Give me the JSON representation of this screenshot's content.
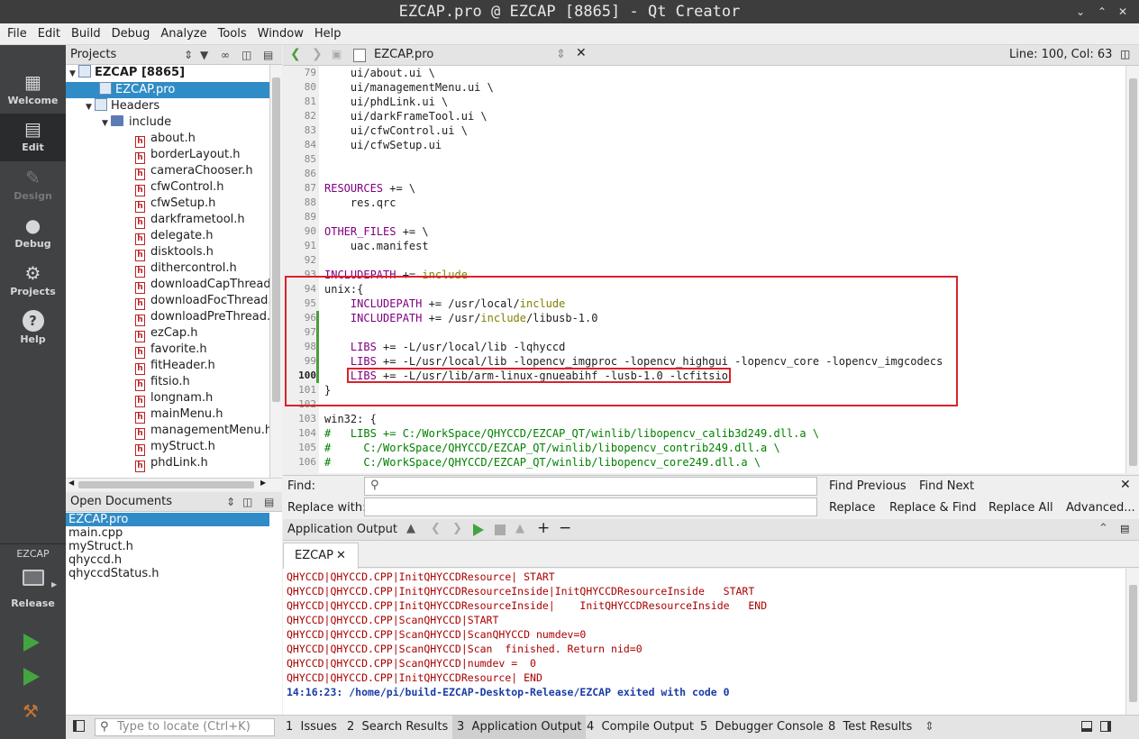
{
  "window": {
    "title": "EZCAP.pro @ EZCAP [8865] - Qt Creator"
  },
  "menu": [
    "File",
    "Edit",
    "Build",
    "Debug",
    "Analyze",
    "Tools",
    "Window",
    "Help"
  ],
  "modes": [
    {
      "label": "Welcome",
      "icon": "grid-icon"
    },
    {
      "label": "Edit",
      "icon": "document-icon"
    },
    {
      "label": "Design",
      "icon": "pen-icon"
    },
    {
      "label": "Debug",
      "icon": "bug-icon"
    },
    {
      "label": "Projects",
      "icon": "wrench-icon"
    },
    {
      "label": "Help",
      "icon": "help-icon"
    }
  ],
  "kit": {
    "project": "EZCAP",
    "config": "Release"
  },
  "projects_pane": {
    "title": "Projects",
    "root": "EZCAP [8865]",
    "pro_file": "EZCAP.pro",
    "headers": "Headers",
    "include": "include",
    "files": [
      "about.h",
      "borderLayout.h",
      "cameraChooser.h",
      "cfwControl.h",
      "cfwSetup.h",
      "darkframetool.h",
      "delegate.h",
      "disktools.h",
      "dithercontrol.h",
      "downloadCapThread.h",
      "downloadFocThread.h",
      "downloadPreThread.h",
      "ezCap.h",
      "favorite.h",
      "fitHeader.h",
      "fitsio.h",
      "longnam.h",
      "mainMenu.h",
      "managementMenu.h",
      "myStruct.h",
      "phdLink.h"
    ]
  },
  "open_documents": {
    "title": "Open Documents",
    "items": [
      "EZCAP.pro",
      "main.cpp",
      "myStruct.h",
      "qhyccd.h",
      "qhyccdStatus.h"
    ]
  },
  "editor": {
    "file": "EZCAP.pro",
    "position": "Line: 100, Col: 63",
    "lines": [
      {
        "n": "79",
        "parts": [
          {
            "t": "    ui/about.ui \\"
          }
        ]
      },
      {
        "n": "80",
        "parts": [
          {
            "t": "    ui/managementMenu.ui \\"
          }
        ]
      },
      {
        "n": "81",
        "parts": [
          {
            "t": "    ui/phdLink.ui \\"
          }
        ]
      },
      {
        "n": "82",
        "parts": [
          {
            "t": "    ui/darkFrameTool.ui \\"
          }
        ]
      },
      {
        "n": "83",
        "parts": [
          {
            "t": "    ui/cfwControl.ui \\"
          }
        ]
      },
      {
        "n": "84",
        "parts": [
          {
            "t": "    ui/cfwSetup.ui"
          }
        ]
      },
      {
        "n": "85",
        "parts": [
          {
            "t": ""
          }
        ]
      },
      {
        "n": "86",
        "parts": [
          {
            "t": ""
          }
        ]
      },
      {
        "n": "87",
        "parts": [
          {
            "t": "RESOURCES",
            "c": "kw"
          },
          {
            "t": " += \\"
          }
        ]
      },
      {
        "n": "88",
        "parts": [
          {
            "t": "    res.qrc"
          }
        ]
      },
      {
        "n": "89",
        "parts": [
          {
            "t": ""
          }
        ]
      },
      {
        "n": "90",
        "parts": [
          {
            "t": "OTHER_FILES",
            "c": "kw"
          },
          {
            "t": " += \\"
          }
        ]
      },
      {
        "n": "91",
        "parts": [
          {
            "t": "    uac.manifest"
          }
        ]
      },
      {
        "n": "92",
        "parts": [
          {
            "t": ""
          }
        ]
      },
      {
        "n": "93",
        "parts": [
          {
            "t": "INCLUDEPATH",
            "c": "kw"
          },
          {
            "t": " += "
          },
          {
            "t": "include",
            "c": "inc"
          }
        ]
      },
      {
        "n": "94",
        "parts": [
          {
            "t": "unix:{"
          }
        ]
      },
      {
        "n": "95",
        "parts": [
          {
            "t": "    "
          },
          {
            "t": "INCLUDEPATH",
            "c": "kw"
          },
          {
            "t": " += /usr/local/"
          },
          {
            "t": "include",
            "c": "inc"
          }
        ]
      },
      {
        "n": "96",
        "parts": [
          {
            "t": "    "
          },
          {
            "t": "INCLUDEPATH",
            "c": "kw"
          },
          {
            "t": " += /usr/"
          },
          {
            "t": "include",
            "c": "inc"
          },
          {
            "t": "/libusb-1.0"
          }
        ]
      },
      {
        "n": "97",
        "parts": [
          {
            "t": ""
          }
        ]
      },
      {
        "n": "98",
        "parts": [
          {
            "t": "    "
          },
          {
            "t": "LIBS",
            "c": "kw"
          },
          {
            "t": " += -L/usr/local/lib -lqhyccd"
          }
        ]
      },
      {
        "n": "99",
        "parts": [
          {
            "t": "    "
          },
          {
            "t": "LIBS",
            "c": "kw"
          },
          {
            "t": " += -L/usr/local/lib -lopencv_imgproc -lopencv_highgui -lopencv_core -lopencv_imgcodecs"
          }
        ]
      },
      {
        "n": "100",
        "parts": [
          {
            "t": "    "
          },
          {
            "t": "LIBS",
            "c": "kw"
          },
          {
            "t": " += -L/usr/lib/arm-linux-gnueabihf -lusb-1.0 -lcfitsio"
          }
        ]
      },
      {
        "n": "101",
        "parts": [
          {
            "t": "}"
          }
        ]
      },
      {
        "n": "102",
        "parts": [
          {
            "t": ""
          }
        ]
      },
      {
        "n": "103",
        "parts": [
          {
            "t": "win32: {"
          }
        ]
      },
      {
        "n": "104",
        "parts": [
          {
            "t": "#   LIBS += C:/WorkSpace/QHYCCD/EZCAP_QT/winlib/libopencv_calib3d249.dll.a \\",
            "c": "cm"
          }
        ]
      },
      {
        "n": "105",
        "parts": [
          {
            "t": "#     C:/WorkSpace/QHYCCD/EZCAP_QT/winlib/libopencv_contrib249.dll.a \\",
            "c": "cm"
          }
        ]
      },
      {
        "n": "106",
        "parts": [
          {
            "t": "#     C:/WorkSpace/QHYCCD/EZCAP_QT/winlib/libopencv_core249.dll.a \\",
            "c": "cm"
          }
        ]
      }
    ]
  },
  "find": {
    "find_label": "Find:",
    "replace_label": "Replace with:",
    "find_previous": "Find Previous",
    "find_next": "Find Next",
    "replace": "Replace",
    "replace_find": "Replace & Find",
    "replace_all": "Replace All",
    "advanced": "Advanced..."
  },
  "app_output": {
    "title": "Application Output",
    "tab": "EZCAP",
    "lines": [
      "QHYCCD|QHYCCD.CPP|InitQHYCCDResource| START",
      "QHYCCD|QHYCCD.CPP|InitQHYCCDResourceInside|InitQHYCCDResourceInside   START",
      "QHYCCD|QHYCCD.CPP|InitQHYCCDResourceInside|    InitQHYCCDResourceInside   END",
      "QHYCCD|QHYCCD.CPP|ScanQHYCCD|START",
      "QHYCCD|QHYCCD.CPP|ScanQHYCCD|ScanQHYCCD numdev=0",
      "QHYCCD|QHYCCD.CPP|ScanQHYCCD|Scan  finished. Return nid=0",
      "QHYCCD|QHYCCD.CPP|ScanQHYCCD|numdev =  0",
      "QHYCCD|QHYCCD.CPP|InitQHYCCDResource| END"
    ],
    "exit_line": "14:16:23: /home/pi/build-EZCAP-Desktop-Release/EZCAP exited with code 0"
  },
  "statusbar": {
    "locator_placeholder": "Type to locate (Ctrl+K)",
    "tabs": [
      {
        "n": "1",
        "label": "Issues"
      },
      {
        "n": "2",
        "label": "Search Results"
      },
      {
        "n": "3",
        "label": "Application Output"
      },
      {
        "n": "4",
        "label": "Compile Output"
      },
      {
        "n": "5",
        "label": "Debugger Console"
      },
      {
        "n": "8",
        "label": "Test Results"
      }
    ]
  }
}
